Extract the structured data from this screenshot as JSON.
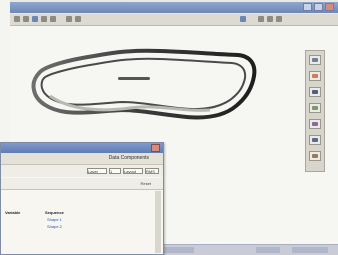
{
  "window": {
    "title": "",
    "toolbar_icons": [
      "tool-icon",
      "tool-icon",
      "tool-icon",
      "tool-icon",
      "tool-icon",
      "tool-icon",
      "tool-icon",
      "tool-icon",
      "tool-icon",
      "tool-icon",
      "tool-icon"
    ]
  },
  "palette": {
    "tools": [
      "select-icon",
      "pen-icon",
      "brush-icon",
      "fill-icon",
      "shape-icon",
      "zoom-icon",
      "color-icon"
    ],
    "colors": [
      "#6f7f9e",
      "#d27a5e",
      "#4f5f7f",
      "#7a9a6a",
      "#8a6a9a",
      "#5a6a8a",
      "#9a7a5a"
    ]
  },
  "dialog": {
    "heading": "Data Components",
    "field1": "Layer",
    "field2": "1",
    "field3": "Layout",
    "field4": "RMS",
    "row2_label": "Reset",
    "col1": "Variable",
    "col2": "Sequence",
    "cell1": "Shape 1",
    "cell2": "Shape 2"
  }
}
